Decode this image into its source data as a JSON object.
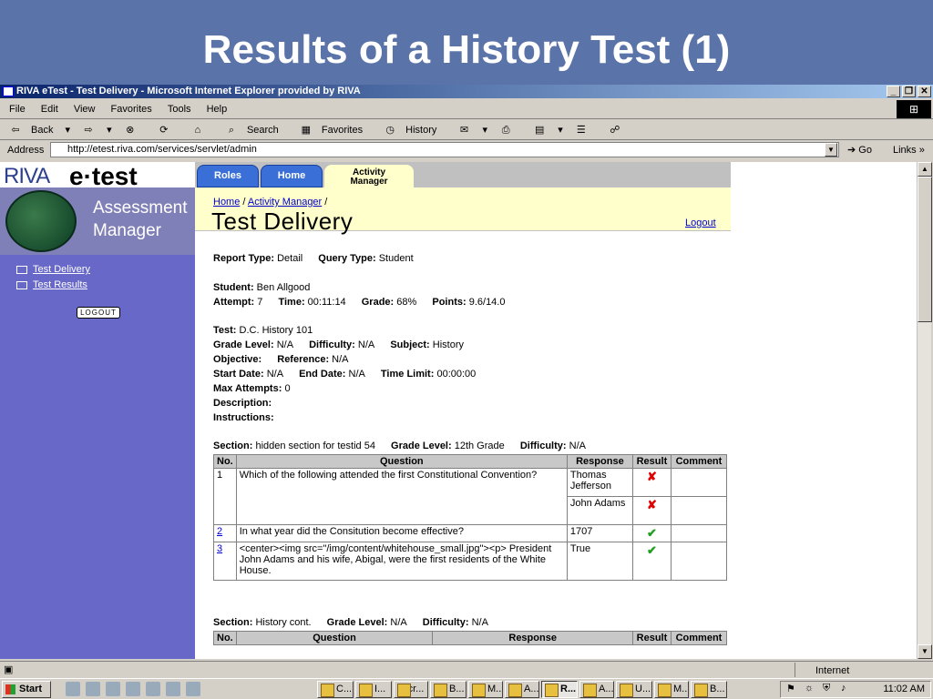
{
  "slide": {
    "title": "Results of a History Test (1)"
  },
  "browser": {
    "window_title": "RIVA eTest - Test Delivery - Microsoft Internet Explorer provided by RIVA",
    "menu": [
      "File",
      "Edit",
      "View",
      "Favorites",
      "Tools",
      "Help"
    ],
    "toolbar": {
      "back": "Back",
      "search": "Search",
      "favorites": "Favorites",
      "history": "History"
    },
    "address_label": "Address",
    "address_url": "http://etest.riva.com/services/servlet/admin",
    "go_label": "Go",
    "links_label": "Links",
    "status_zone": "Internet"
  },
  "sidebar": {
    "logo_riva": "RIVA",
    "logo_etest": "e·test",
    "assess_line1": "Assessment",
    "assess_line2": "Manager",
    "links": [
      "Test Delivery",
      "Test Results"
    ],
    "logout_button": "LOGOUT"
  },
  "tabs": [
    {
      "label": "Roles"
    },
    {
      "label": "Home"
    },
    {
      "label_line1": "Activity",
      "label_line2": "Manager"
    }
  ],
  "header": {
    "breadcrumb_home": "Home",
    "breadcrumb_sep": " / ",
    "breadcrumb_activity": "Activity Manager",
    "breadcrumb_end": " /",
    "title": "Test Delivery",
    "logout_link": "Logout"
  },
  "report": {
    "report_type_label": "Report Type:",
    "report_type": "Detail",
    "query_type_label": "Query Type:",
    "query_type": "Student",
    "student_label": "Student:",
    "student": "Ben Allgood",
    "attempt_label": "Attempt:",
    "attempt": "7",
    "time_label": "Time:",
    "time": "00:11:14",
    "grade_label": "Grade:",
    "grade": "68%",
    "points_label": "Points:",
    "points": "9.6/14.0",
    "test_label": "Test:",
    "test": "D.C. History 101",
    "grade_level_label": "Grade Level:",
    "grade_level": "N/A",
    "difficulty_label": "Difficulty:",
    "difficulty": "N/A",
    "subject_label": "Subject:",
    "subject": "History",
    "objective_label": "Objective:",
    "reference_label": "Reference:",
    "reference": "N/A",
    "start_date_label": "Start Date:",
    "start_date": "N/A",
    "end_date_label": "End Date:",
    "end_date": "N/A",
    "time_limit_label": "Time Limit:",
    "time_limit": "00:00:00",
    "max_attempts_label": "Max Attempts:",
    "max_attempts": "0",
    "description_label": "Description:",
    "instructions_label": "Instructions:"
  },
  "section1": {
    "section_label": "Section:",
    "section": "hidden section for testid 54",
    "grade_level_label": "Grade Level:",
    "grade_level": "12th Grade",
    "difficulty_label": "Difficulty:",
    "difficulty": "N/A",
    "columns": [
      "No.",
      "Question",
      "Response",
      "Result",
      "Comment"
    ],
    "rows": [
      {
        "no": "1",
        "question": "Which of the following attended the first Constitutional Convention?",
        "responses": [
          "Thomas Jefferson",
          "John Adams"
        ]
      },
      {
        "no": "2",
        "question": "In what year did the Consitution become effective?",
        "response": "1707"
      },
      {
        "no": "3",
        "question": "<center><img src=\"/img/content/whitehouse_small.jpg\"><p> President John Adams and his wife, Abigal, were the first residents of the White House.",
        "response": "True"
      }
    ]
  },
  "section2": {
    "section_label": "Section:",
    "section": "History cont.",
    "grade_level_label": "Grade Level:",
    "grade_level": "N/A",
    "difficulty_label": "Difficulty:",
    "difficulty": "N/A",
    "columns": [
      "No.",
      "Question",
      "Response",
      "Result",
      "Comment"
    ]
  },
  "taskbar": {
    "start": "Start",
    "tasks": [
      "C...",
      "I...",
      "Micr...",
      "B...",
      "M...",
      "A...",
      "R...",
      "A...",
      "U...",
      "M...",
      "B..."
    ],
    "clock": "11:02 AM"
  }
}
